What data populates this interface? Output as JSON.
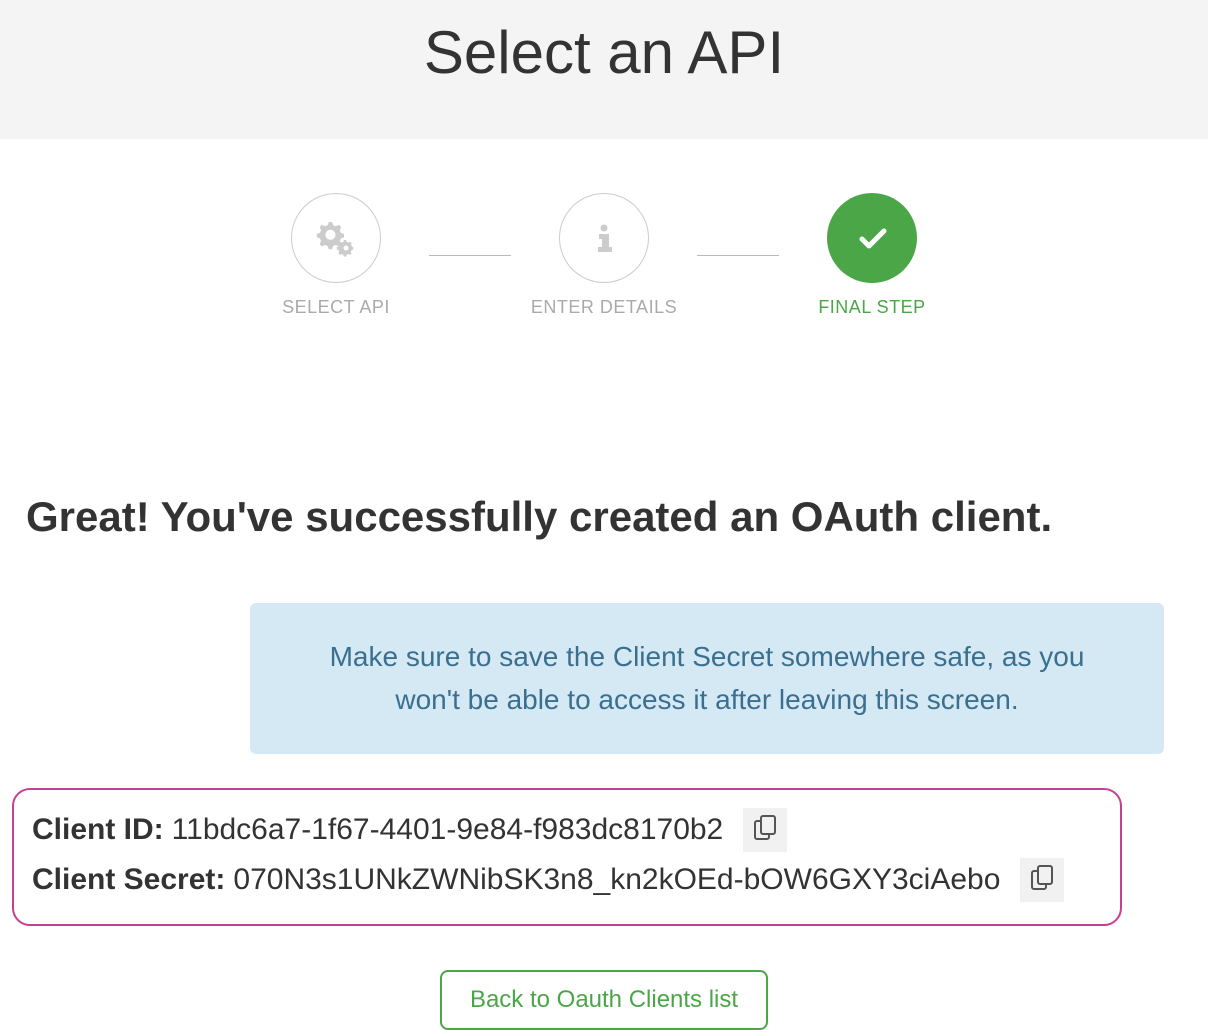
{
  "header": {
    "title": "Select an API"
  },
  "stepper": {
    "steps": [
      {
        "label": "SELECT API",
        "active": false
      },
      {
        "label": "ENTER DETAILS",
        "active": false
      },
      {
        "label": "FINAL STEP",
        "active": true
      }
    ]
  },
  "main": {
    "success_heading": "Great! You've successfully created an OAuth client.",
    "info_message": "Make sure to save the Client Secret somewhere safe, as you won't be able to access it after leaving this screen."
  },
  "credentials": {
    "client_id_label": "Client ID:",
    "client_id_value": "11bdc6a7-1f67-4401-9e84-f983dc8170b2",
    "client_secret_label": "Client Secret:",
    "client_secret_value": "070N3s1UNkZWNibSK3n8_kn2kOEd-bOW6GXY3ciAebo"
  },
  "actions": {
    "back_button": "Back to Oauth Clients list"
  }
}
